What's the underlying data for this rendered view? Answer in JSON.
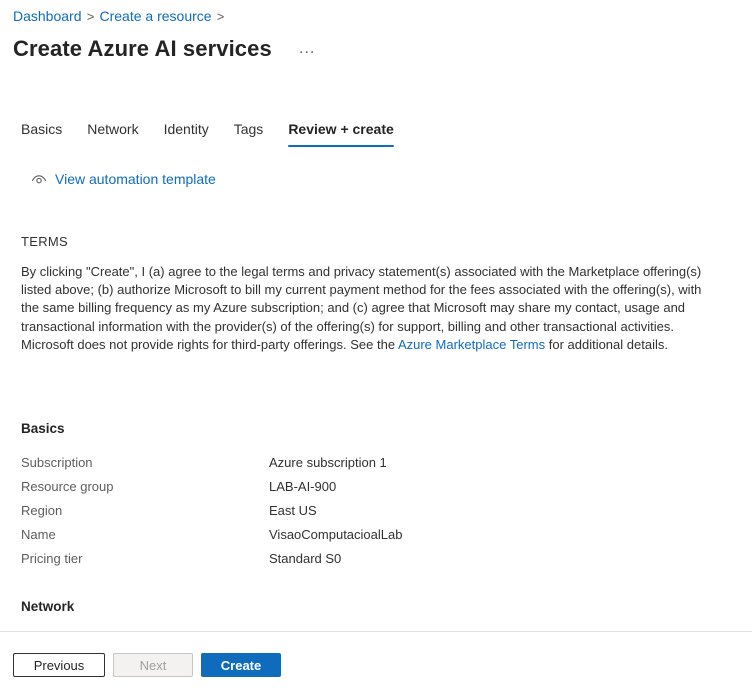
{
  "breadcrumb": {
    "items": [
      "Dashboard",
      "Create a resource"
    ],
    "separator": ">"
  },
  "page": {
    "title": "Create Azure AI services",
    "more_label": "..."
  },
  "tabs": [
    {
      "label": "Basics",
      "active": false
    },
    {
      "label": "Network",
      "active": false
    },
    {
      "label": "Identity",
      "active": false
    },
    {
      "label": "Tags",
      "active": false
    },
    {
      "label": "Review + create",
      "active": true
    }
  ],
  "automation": {
    "label": "View automation template",
    "icon": "eye-icon"
  },
  "terms": {
    "heading": "TERMS",
    "text_before_link": "By clicking \"Create\", I (a) agree to the legal terms and privacy statement(s) associated with the Marketplace offering(s) listed above; (b) authorize Microsoft to bill my current payment method for the fees associated with the offering(s), with the same billing frequency as my Azure subscription; and (c) agree that Microsoft may share my contact, usage and transactional information with the provider(s) of the offering(s) for support, billing and other transactional activities. Microsoft does not provide rights for third-party offerings. See the ",
    "link_label": "Azure Marketplace Terms",
    "text_after_link": " for additional details."
  },
  "basics": {
    "heading": "Basics",
    "rows": [
      {
        "key": "Subscription",
        "value": "Azure subscription 1"
      },
      {
        "key": "Resource group",
        "value": "LAB-AI-900"
      },
      {
        "key": "Region",
        "value": "East US"
      },
      {
        "key": "Name",
        "value": "VisaoComputacioalLab"
      },
      {
        "key": "Pricing tier",
        "value": "Standard S0"
      }
    ]
  },
  "network": {
    "heading": "Network"
  },
  "footer": {
    "previous_label": "Previous",
    "next_label": "Next",
    "create_label": "Create"
  },
  "colors": {
    "accent": "#0f6cbd",
    "text": "#323130",
    "muted": "#605e5c"
  }
}
